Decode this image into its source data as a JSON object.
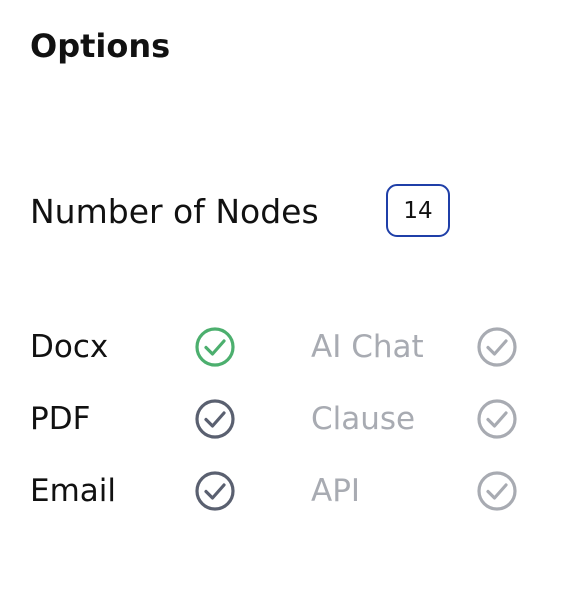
{
  "title": "Options",
  "nodes": {
    "label": "Number of Nodes",
    "value": "14"
  },
  "options": [
    {
      "label": "Docx",
      "state": "selected",
      "color": "#4caf6e"
    },
    {
      "label": "PDF",
      "state": "enabled",
      "color": "#5a6070"
    },
    {
      "label": "Email",
      "state": "enabled",
      "color": "#5a6070"
    },
    {
      "label": "AI Chat",
      "state": "disabled",
      "color": "#a8abb2"
    },
    {
      "label": "Clause",
      "state": "disabled",
      "color": "#a8abb2"
    },
    {
      "label": "API",
      "state": "disabled",
      "color": "#a8abb2"
    }
  ],
  "colors": {
    "input_border": "#1f3fa8",
    "text": "#111111",
    "muted_text": "#a8abb2"
  }
}
